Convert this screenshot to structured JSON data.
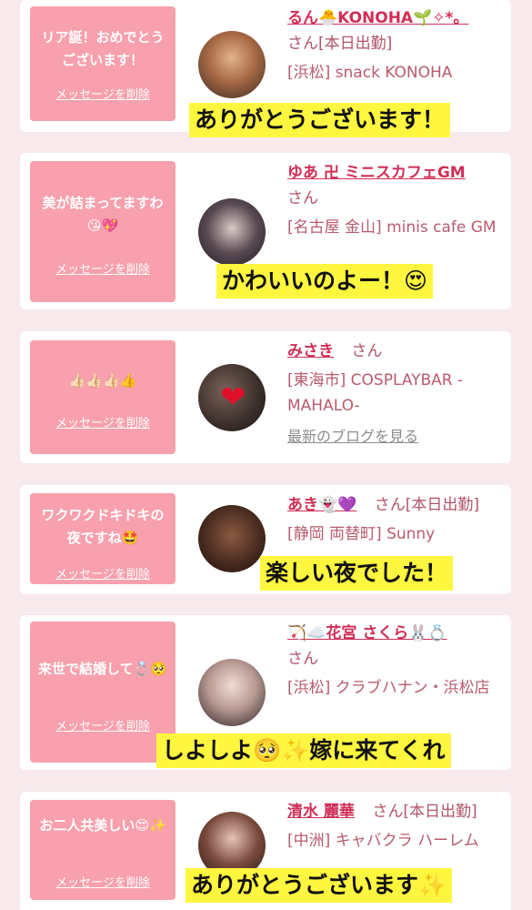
{
  "cards": [
    {
      "message": "リア誕！おめでとうございます！",
      "delete_label": "メッセージを削除",
      "name": "るん🐣KONOHA🌱✧*。",
      "san": "さん",
      "status": "[本日出勤]",
      "shop": "[浜松] snack KONOHA",
      "banner": "ありがとうございます！"
    },
    {
      "message": "美が詰まってますわ😘💖",
      "delete_label": "メッセージを削除",
      "name": "ゆあ 卍 ミニスカフェGM",
      "san": "さん",
      "shop": "[名古屋 金山] minis cafe GM",
      "banner": "かわいいのよー！😍"
    },
    {
      "message": "👍🏻👍🏻👍🏻👍",
      "delete_label": "メッセージを削除",
      "name": "みさき",
      "san": "さん",
      "shop": "[東海市] COSPLAYBAR -MAHALO-",
      "blog": "最新のブログを見る"
    },
    {
      "message": "ワクワクドキドキの夜ですね🤩",
      "delete_label": "メッセージを削除",
      "name": "あき👻💜",
      "san": "さん",
      "status": "[本日出勤]",
      "shop": "[静岡 両替町] Sunny",
      "banner": "楽しい夜でした！"
    },
    {
      "message": "来世で結婚して💍🥺",
      "delete_label": "メッセージを削除",
      "name": "🏹☁️花宮 さくら🐰💍",
      "san": "さん",
      "shop": "[浜松] クラブハナン・浜松店",
      "banner": "しよしよ🥺✨嫁に来てくれ"
    },
    {
      "message": "お二人共美しい😍✨",
      "delete_label": "メッセージを削除",
      "name": "清水 麗華",
      "san": "さん",
      "status": "[本日出勤]",
      "shop": "[中洲] キャバクラ ハーレム",
      "banner": "ありがとうございます✨"
    }
  ],
  "colors": {
    "background": "#f7e9ec",
    "bubble": "#f8a0ad",
    "name": "#d02f57",
    "banner": "#fff640"
  },
  "icons": {
    "avatar": "user-photo",
    "heart_overlay": "heart-icon"
  }
}
